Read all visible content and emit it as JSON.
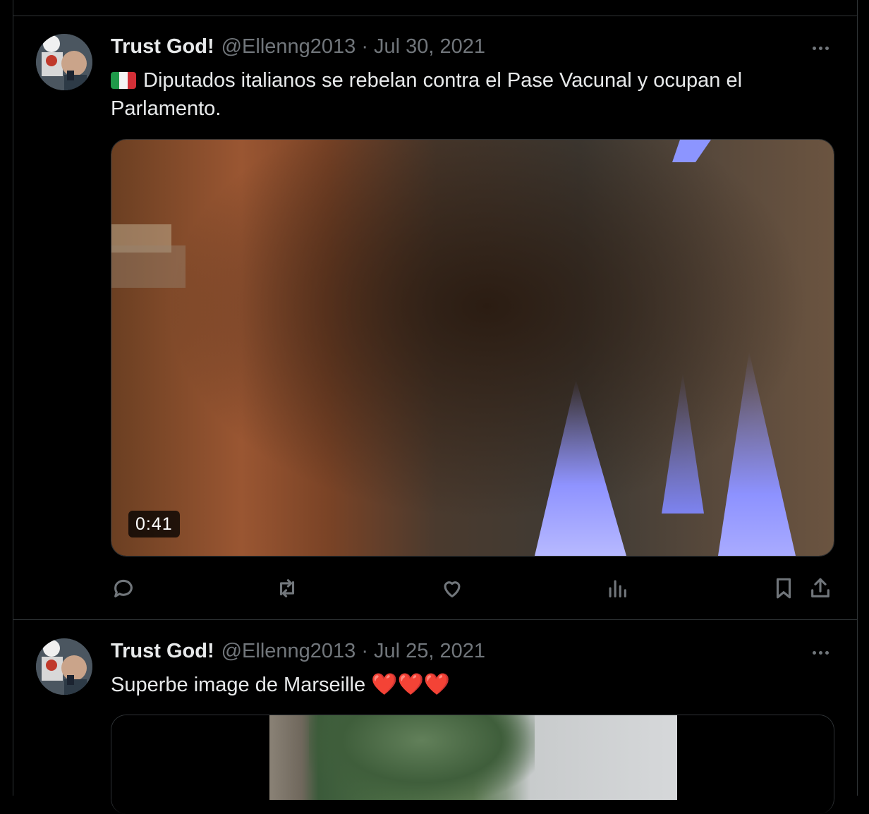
{
  "tweets": [
    {
      "author_name": "Trust God!",
      "handle": "@Ellenng2013",
      "separator": "·",
      "date": "Jul 30, 2021",
      "flag_icon": "italy-flag-icon",
      "text": "Diputados italianos se rebelan contra el Pase Vacunal y ocupan el Parlamento.",
      "media": {
        "type": "video",
        "duration": "0:41"
      },
      "actions": [
        "reply-icon",
        "retweet-icon",
        "like-icon",
        "views-icon",
        "bookmark-icon",
        "share-icon"
      ]
    },
    {
      "author_name": "Trust God!",
      "handle": "@Ellenng2013",
      "separator": "·",
      "date": "Jul 25, 2021",
      "text": "Superbe image de Marseille",
      "emoji": "❤️❤️❤️",
      "media": {
        "type": "image"
      }
    }
  ],
  "colors": {
    "background": "#000000",
    "text_primary": "#e7e9ea",
    "text_secondary": "#71767b",
    "border": "#2f3336",
    "heart": "#e0245e"
  }
}
